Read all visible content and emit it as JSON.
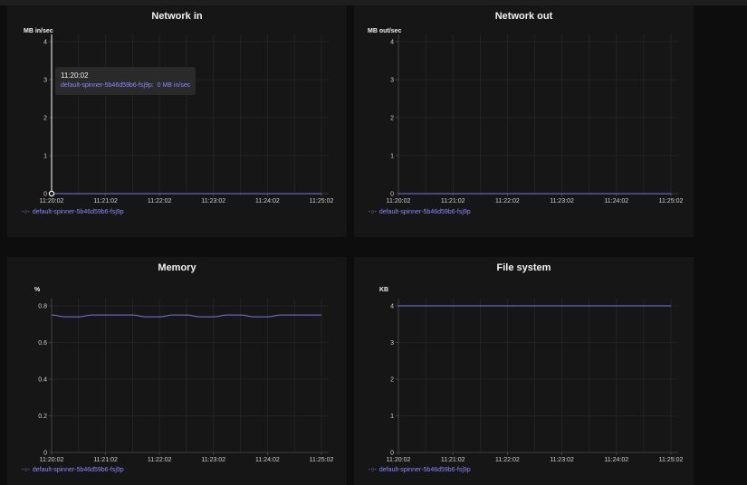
{
  "colors": {
    "series": "#7b74e8",
    "grid": "#2a2a2a",
    "axis": "#4a4a4a",
    "tick_text": "#d0d0d0",
    "cursor": "#ffffff"
  },
  "tooltip": {
    "time": "11:20:02",
    "series_name": "default-spinner-5b46d59b6-fsj9p:",
    "value": "0 MB in/sec"
  },
  "chart_data": [
    {
      "type": "line",
      "title": "Network in",
      "ylabel": "MB in/sec",
      "x": [
        "11:20:02",
        "11:21:02",
        "11:22:02",
        "11:23:02",
        "11:24:02",
        "11:25:02"
      ],
      "ylim": [
        0,
        4
      ],
      "yticks": [
        "0",
        "1",
        "2",
        "3",
        "4"
      ],
      "grid": true,
      "legend": "bottom-left",
      "series": [
        {
          "name": "default-spinner-5b46d59b6-fsj9p",
          "values": [
            0,
            0,
            0,
            0,
            0,
            0
          ]
        }
      ]
    },
    {
      "type": "line",
      "title": "Network out",
      "ylabel": "MB out/sec",
      "x": [
        "11:20:02",
        "11:21:02",
        "11:22:02",
        "11:23:02",
        "11:24:02",
        "11:25:02"
      ],
      "ylim": [
        0,
        4
      ],
      "yticks": [
        "0",
        "1",
        "2",
        "3",
        "4"
      ],
      "grid": true,
      "legend": "bottom-left",
      "series": [
        {
          "name": "default-spinner-5b46d59b6-fsj9p",
          "values": [
            0,
            0,
            0,
            0,
            0,
            0
          ]
        }
      ]
    },
    {
      "type": "line",
      "title": "Memory",
      "ylabel": "%",
      "x": [
        "11:20:02",
        "11:21:02",
        "11:22:02",
        "11:23:02",
        "11:24:02",
        "11:25:02"
      ],
      "ylim": [
        0,
        0.8
      ],
      "yticks": [
        "0",
        "0.2",
        "0.4",
        "0.6",
        "0.8"
      ],
      "grid": true,
      "legend": "bottom-left",
      "series": [
        {
          "name": "default-spinner-5b46d59b6-fsj9p",
          "values": [
            0.75,
            0.74,
            0.74,
            0.75,
            0.75,
            0.75,
            0.75,
            0.74,
            0.74,
            0.75,
            0.75,
            0.74,
            0.74,
            0.75,
            0.75,
            0.74,
            0.74,
            0.75,
            0.75,
            0.75,
            0.75
          ]
        }
      ]
    },
    {
      "type": "line",
      "title": "File system",
      "ylabel": "KB",
      "x": [
        "11:20:02",
        "11:21:02",
        "11:22:02",
        "11:23:02",
        "11:24:02",
        "11:25:02"
      ],
      "ylim": [
        0,
        4
      ],
      "yticks": [
        "0",
        "1",
        "2",
        "3",
        "4"
      ],
      "grid": true,
      "legend": "bottom-left",
      "series": [
        {
          "name": "default-spinner-5b46d59b6-fsj9p",
          "values": [
            4,
            4,
            4,
            4,
            4,
            4
          ]
        }
      ]
    }
  ]
}
